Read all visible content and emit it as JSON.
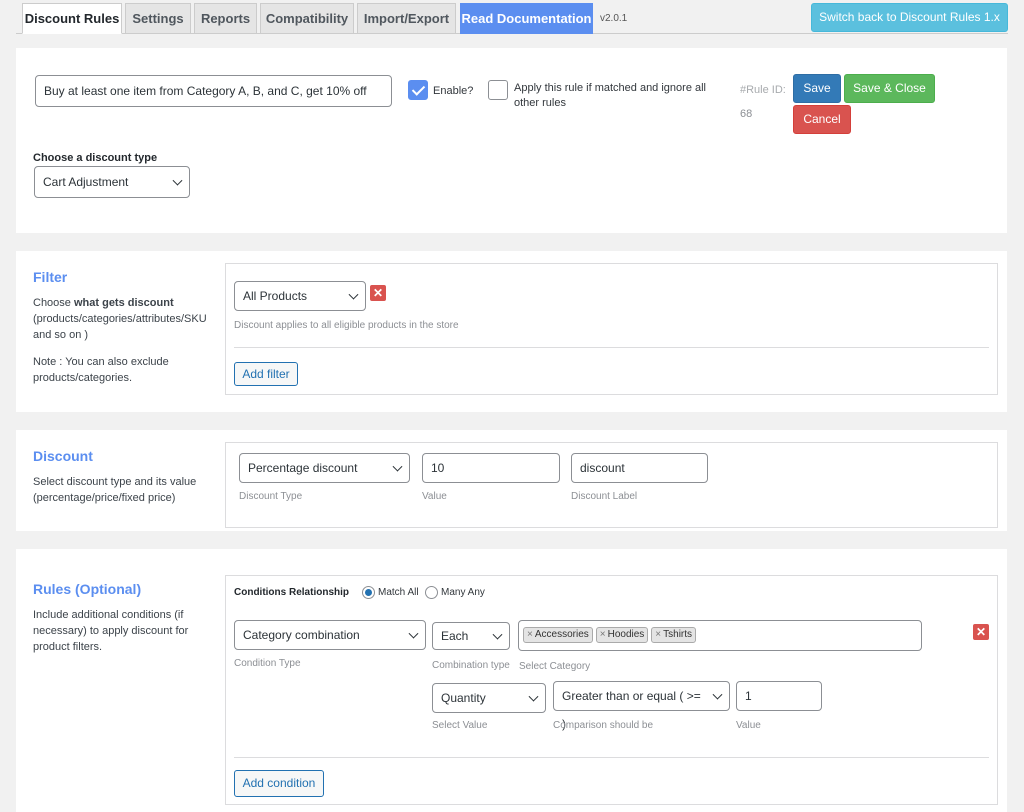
{
  "tabs": [
    {
      "label": "Discount Rules"
    },
    {
      "label": "Settings"
    },
    {
      "label": "Reports"
    },
    {
      "label": "Compatibility"
    },
    {
      "label": "Import/Export"
    },
    {
      "label": "Read Documentation"
    }
  ],
  "version": "v2.0.1",
  "switch_label": "Switch back to Discount Rules 1.x",
  "rule": {
    "title_value": "Buy at least one item from Category A, B, and C, get 10% off",
    "enable_label": "Enable?",
    "enable_checked": true,
    "apply_label": "Apply this rule if matched and ignore all other rules",
    "rule_id_label": "#Rule ID:",
    "rule_id": "68",
    "save_label": "Save",
    "save_close_label": "Save & Close",
    "cancel_label": "Cancel",
    "discount_type_label": "Choose a discount type",
    "discount_type_value": "Cart Adjustment"
  },
  "filter": {
    "title": "Filter",
    "desc_prefix": "Choose ",
    "desc_bold": "what gets discount",
    "desc_rest": "(products/categories/attributes/SKU and so on )",
    "note": "Note : You can also exclude products/categories.",
    "select_value": "All Products",
    "hint": "Discount applies to all eligible products in the store",
    "add_label": "Add filter"
  },
  "discount": {
    "title": "Discount",
    "desc": "Select discount type and its value (percentage/price/fixed price)",
    "type_value": "Percentage discount",
    "type_hint": "Discount Type",
    "value": "10",
    "value_hint": "Value",
    "label_value": "discount",
    "label_hint": "Discount Label"
  },
  "rules": {
    "title": "Rules (Optional)",
    "desc": "Include additional conditions (if necessary) to apply discount for product filters.",
    "relationship_label": "Conditions Relationship",
    "match_all": "Match All",
    "many_any": "Many Any",
    "condition_type_value": "Category combination",
    "condition_type_hint": "Condition Type",
    "combination_value": "Each",
    "combination_hint": "Combination type",
    "category_hint": "Select Category",
    "categories": [
      "Accessories",
      "Hoodies",
      "Tshirts"
    ],
    "select_value": "Quantity",
    "select_value_hint": "Select Value",
    "comparison_value": "Greater than or equal ( >= )",
    "comparison_hint": "Comparison should be",
    "qty_value": "1",
    "qty_hint": "Value",
    "add_condition_label": "Add condition"
  },
  "colors": {
    "accent": "#5b8ef0",
    "save": "#337ab7",
    "save_close": "#5cb85c",
    "cancel": "#d9534f",
    "switch": "#5bc0de"
  }
}
